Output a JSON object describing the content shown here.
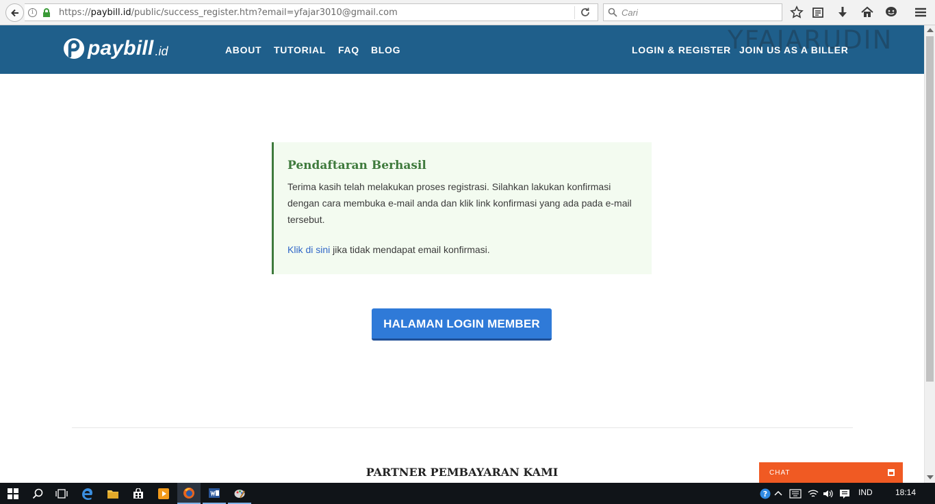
{
  "browser": {
    "url_prefix": "https://",
    "url_host": "paybill.id",
    "url_path": "/public/success_register.htm?email=yfajar3010@gmail.com",
    "search_placeholder": "Cari"
  },
  "header": {
    "logo_text": "paybill",
    "logo_suffix": ".id",
    "nav": [
      "ABOUT",
      "TUTORIAL",
      "FAQ",
      "BLOG"
    ],
    "right_nav": [
      "LOGIN & REGISTER",
      "JOIN US AS A BILLER"
    ],
    "watermark": "YFAJARUDIN"
  },
  "alert": {
    "title": "Pendaftaran Berhasil",
    "body": "Terima kasih telah melakukan proses registrasi. Silahkan lakukan konfirmasi dengan cara membuka e-mail anda dan klik link konfirmasi yang ada pada e-mail tersebut.",
    "link_text": "Klik di sini",
    "link_rest": " jika tidak mendapat email konfirmasi."
  },
  "login_button": "HALAMAN LOGIN MEMBER",
  "partner_title": "PARTNER PEMBAYARAN KAMI",
  "chat": {
    "label": "CHAT"
  },
  "taskbar": {
    "language": "IND",
    "time": "18:14"
  },
  "colors": {
    "header": "#1f5f8b",
    "success": "#3e7a3c",
    "button": "#2f7ad8",
    "chat": "#f05a23"
  }
}
